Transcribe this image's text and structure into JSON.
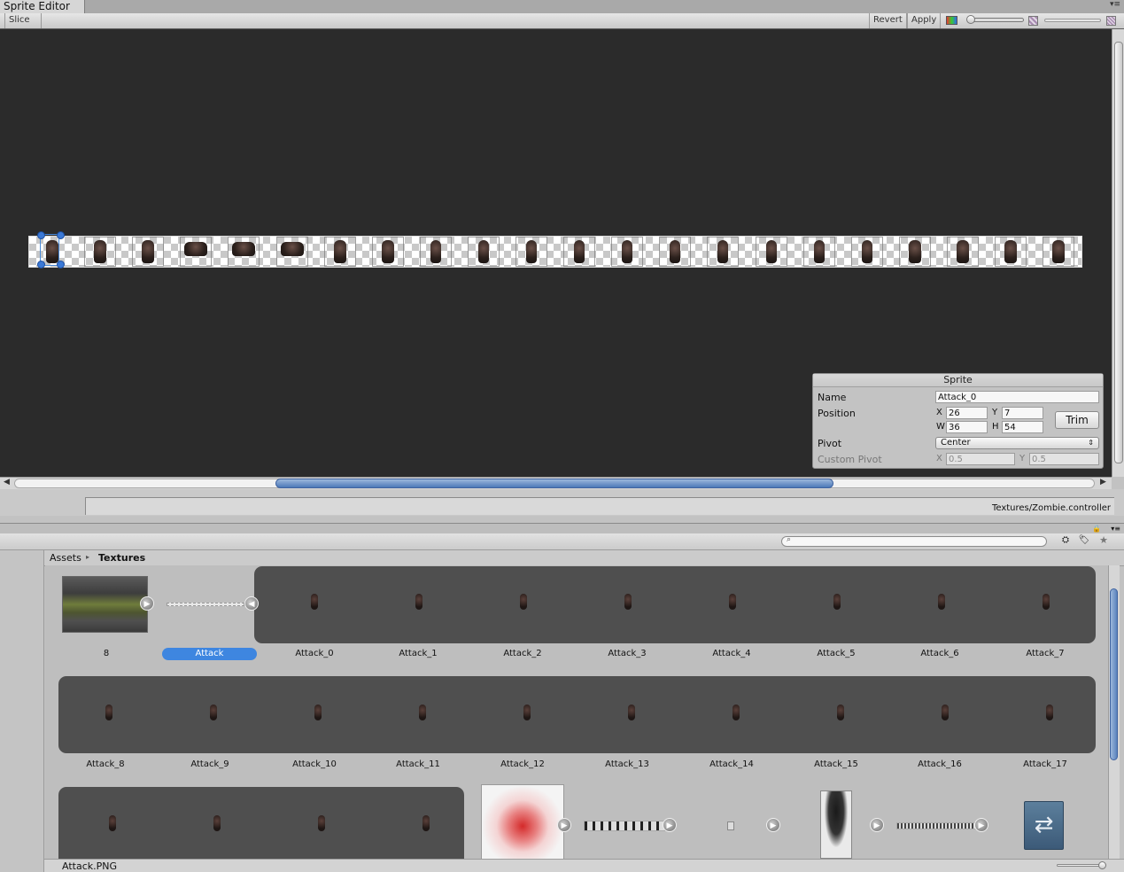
{
  "window": {
    "title": "Sprite Editor",
    "menu_glyph": "▾≡"
  },
  "toolbar": {
    "slice_label": "Slice ↕",
    "revert_label": "Revert",
    "apply_label": "Apply"
  },
  "sprite_panel": {
    "title": "Sprite",
    "name_label": "Name",
    "name_value": "Attack_0",
    "position_label": "Position",
    "x_label": "X",
    "x_value": "26",
    "y_label": "Y",
    "y_value": "7",
    "w_label": "W",
    "w_value": "36",
    "h_label": "H",
    "h_value": "54",
    "trim_label": "Trim",
    "pivot_label": "Pivot",
    "pivot_value": "Center",
    "custom_pivot_label": "Custom Pivot",
    "cpx_label": "X",
    "cpx_value": "0.5",
    "cpy_label": "Y",
    "cpy_value": "0.5"
  },
  "status": {
    "path": "Textures/Zombie.controller"
  },
  "breadcrumb": {
    "root": "Assets",
    "separator": "▸",
    "current": "Textures"
  },
  "assets": {
    "row1": [
      "8",
      "Attack",
      "Attack_0",
      "Attack_1",
      "Attack_2",
      "Attack_3",
      "Attack_4",
      "Attack_5",
      "Attack_6",
      "Attack_7"
    ],
    "row2": [
      "Attack_8",
      "Attack_9",
      "Attack_10",
      "Attack_11",
      "Attack_12",
      "Attack_13",
      "Attack_14",
      "Attack_15",
      "Attack_16",
      "Attack_17"
    ]
  },
  "footer": {
    "selected": "Attack.PNG"
  },
  "colors": {
    "accent": "#3b79d6",
    "canvas": "#2b2b2b",
    "group": "#4f4f4f"
  }
}
